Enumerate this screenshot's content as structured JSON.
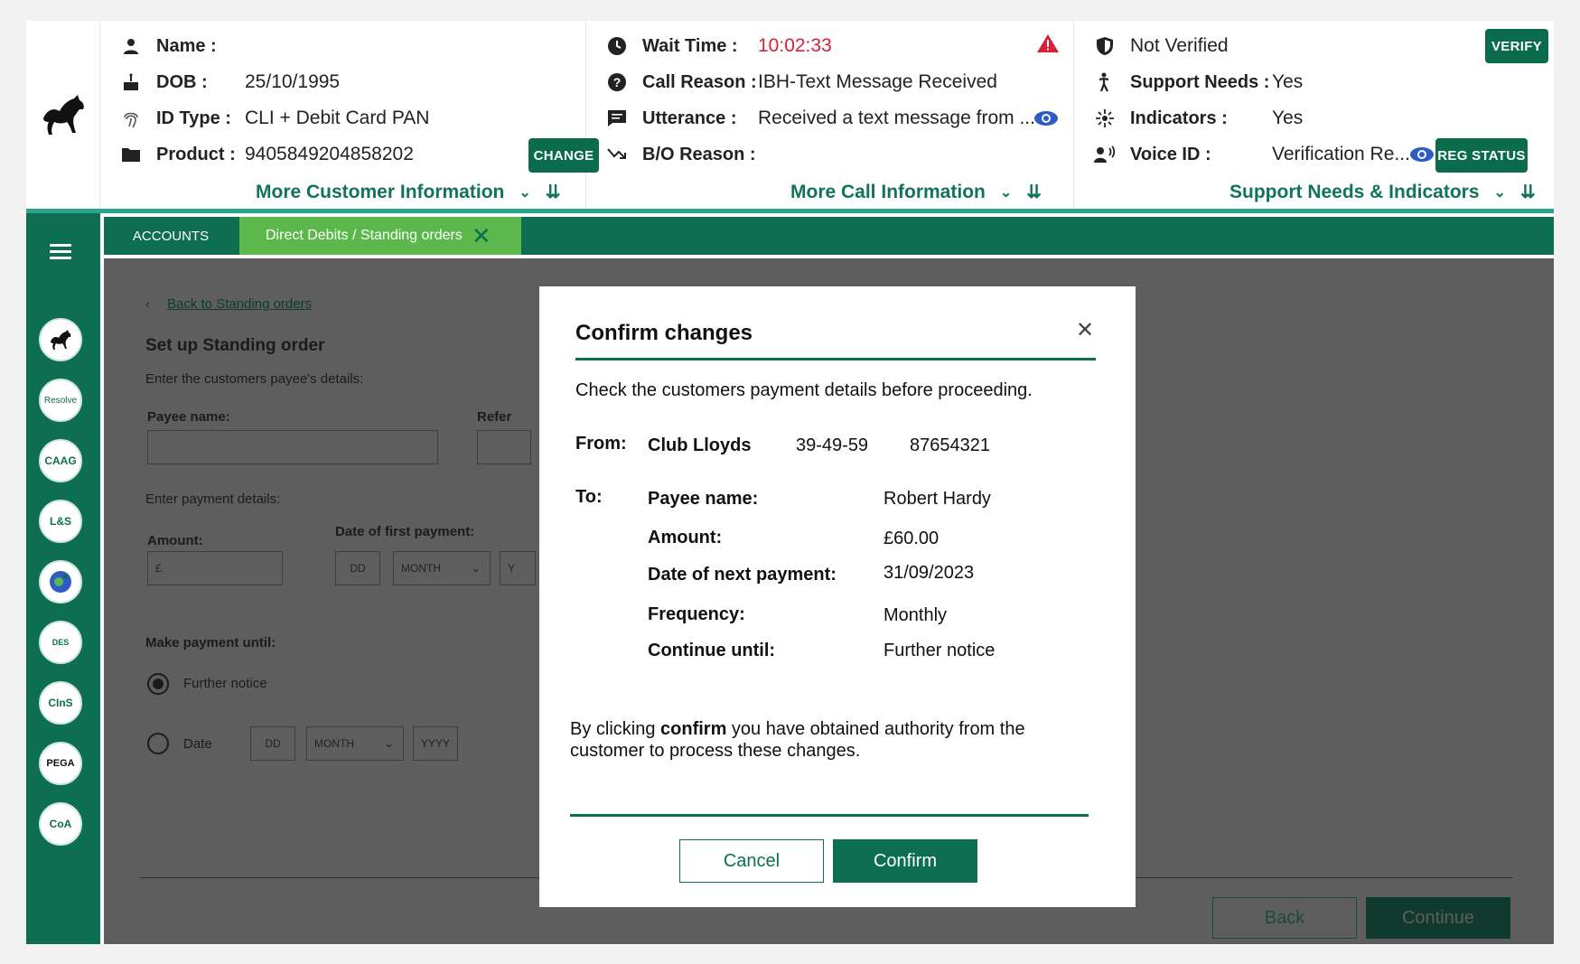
{
  "header": {
    "customer": {
      "name_label": "Name :",
      "name_value": "",
      "dob_label": "DOB :",
      "dob_value": "25/10/1995",
      "idtype_label": "ID Type :",
      "idtype_value": "CLI + Debit Card PAN",
      "product_label": "Product :",
      "product_value": "9405849204858202",
      "change_button": "CHANGE",
      "more_link": "More Customer Information"
    },
    "call": {
      "wait_label": "Wait Time :",
      "wait_value": "10:02:33",
      "reason_label": "Call Reason :",
      "reason_value": "IBH-Text Message Received",
      "utterance_label": "Utterance :",
      "utterance_value": "Received a text message from ...",
      "bo_label": "B/O Reason :",
      "bo_value": "",
      "more_link": "More Call Information"
    },
    "verify": {
      "status": "Not Verified",
      "verify_button": "VERIFY",
      "support_label": "Support Needs :",
      "support_value": "Yes",
      "indicators_label": "Indicators :",
      "indicators_value": "Yes",
      "voice_label": "Voice ID :",
      "voice_value": "Verification Re...",
      "reg_button": "REG STATUS",
      "more_link": "Support Needs & Indicators"
    }
  },
  "rail": {
    "items": [
      "Resolve",
      "CAAG",
      "L&S",
      "DES",
      "CInS",
      "PEGA",
      "CoA"
    ]
  },
  "tabs": {
    "accounts": "ACCOUNTS",
    "active": "Direct Debits / Standing orders"
  },
  "form": {
    "back_link": "Back to Standing orders",
    "heading": "Set up Standing order",
    "payee_intro": "Enter the customers payee's details:",
    "payee_name_label": "Payee name:",
    "reference_label_partial": "Refer",
    "payment_intro": "Enter payment details:",
    "amount_label": "Amount:",
    "amount_prefix": "£",
    "first_payment_label": "Date of first payment:",
    "dd": "DD",
    "month": "MONTH",
    "year_partial": "Y",
    "until_label": "Make payment until:",
    "further_notice": "Further notice",
    "date_option": "Date",
    "until_dd": "DD",
    "until_month": "MONTH",
    "until_yyyy": "YYYY",
    "back_button": "Back",
    "continue_button": "Continue"
  },
  "modal": {
    "title": "Confirm  changes",
    "subtitle": "Check the customers payment details  before proceeding.",
    "from_label": "From:",
    "from_account_name": "Club Lloyds",
    "from_sort_code": "39-49-59",
    "from_account_number": "87654321",
    "to_label": "To:",
    "payee_label": "Payee name:",
    "payee_value": "Robert Hardy",
    "amount_label": "Amount:",
    "amount_value": "£60.00",
    "next_payment_label": "Date of next payment:",
    "next_payment_value": "31/09/2023",
    "frequency_label": "Frequency:",
    "frequency_value": "Monthly",
    "continue_label": "Continue until:",
    "continue_value": "Further notice",
    "disclaimer_pre": "By clicking ",
    "disclaimer_bold": "confirm",
    "disclaimer_post": " you have obtained authority from the customer to process these changes.",
    "cancel_button": "Cancel",
    "confirm_button": "Confirm"
  },
  "colors": {
    "brand_green": "#0e6e51",
    "accent_teal": "#2aa58e",
    "tab_active": "#5cb84a",
    "alert_red": "#d8203b",
    "eye_blue": "#2d5bc8"
  }
}
